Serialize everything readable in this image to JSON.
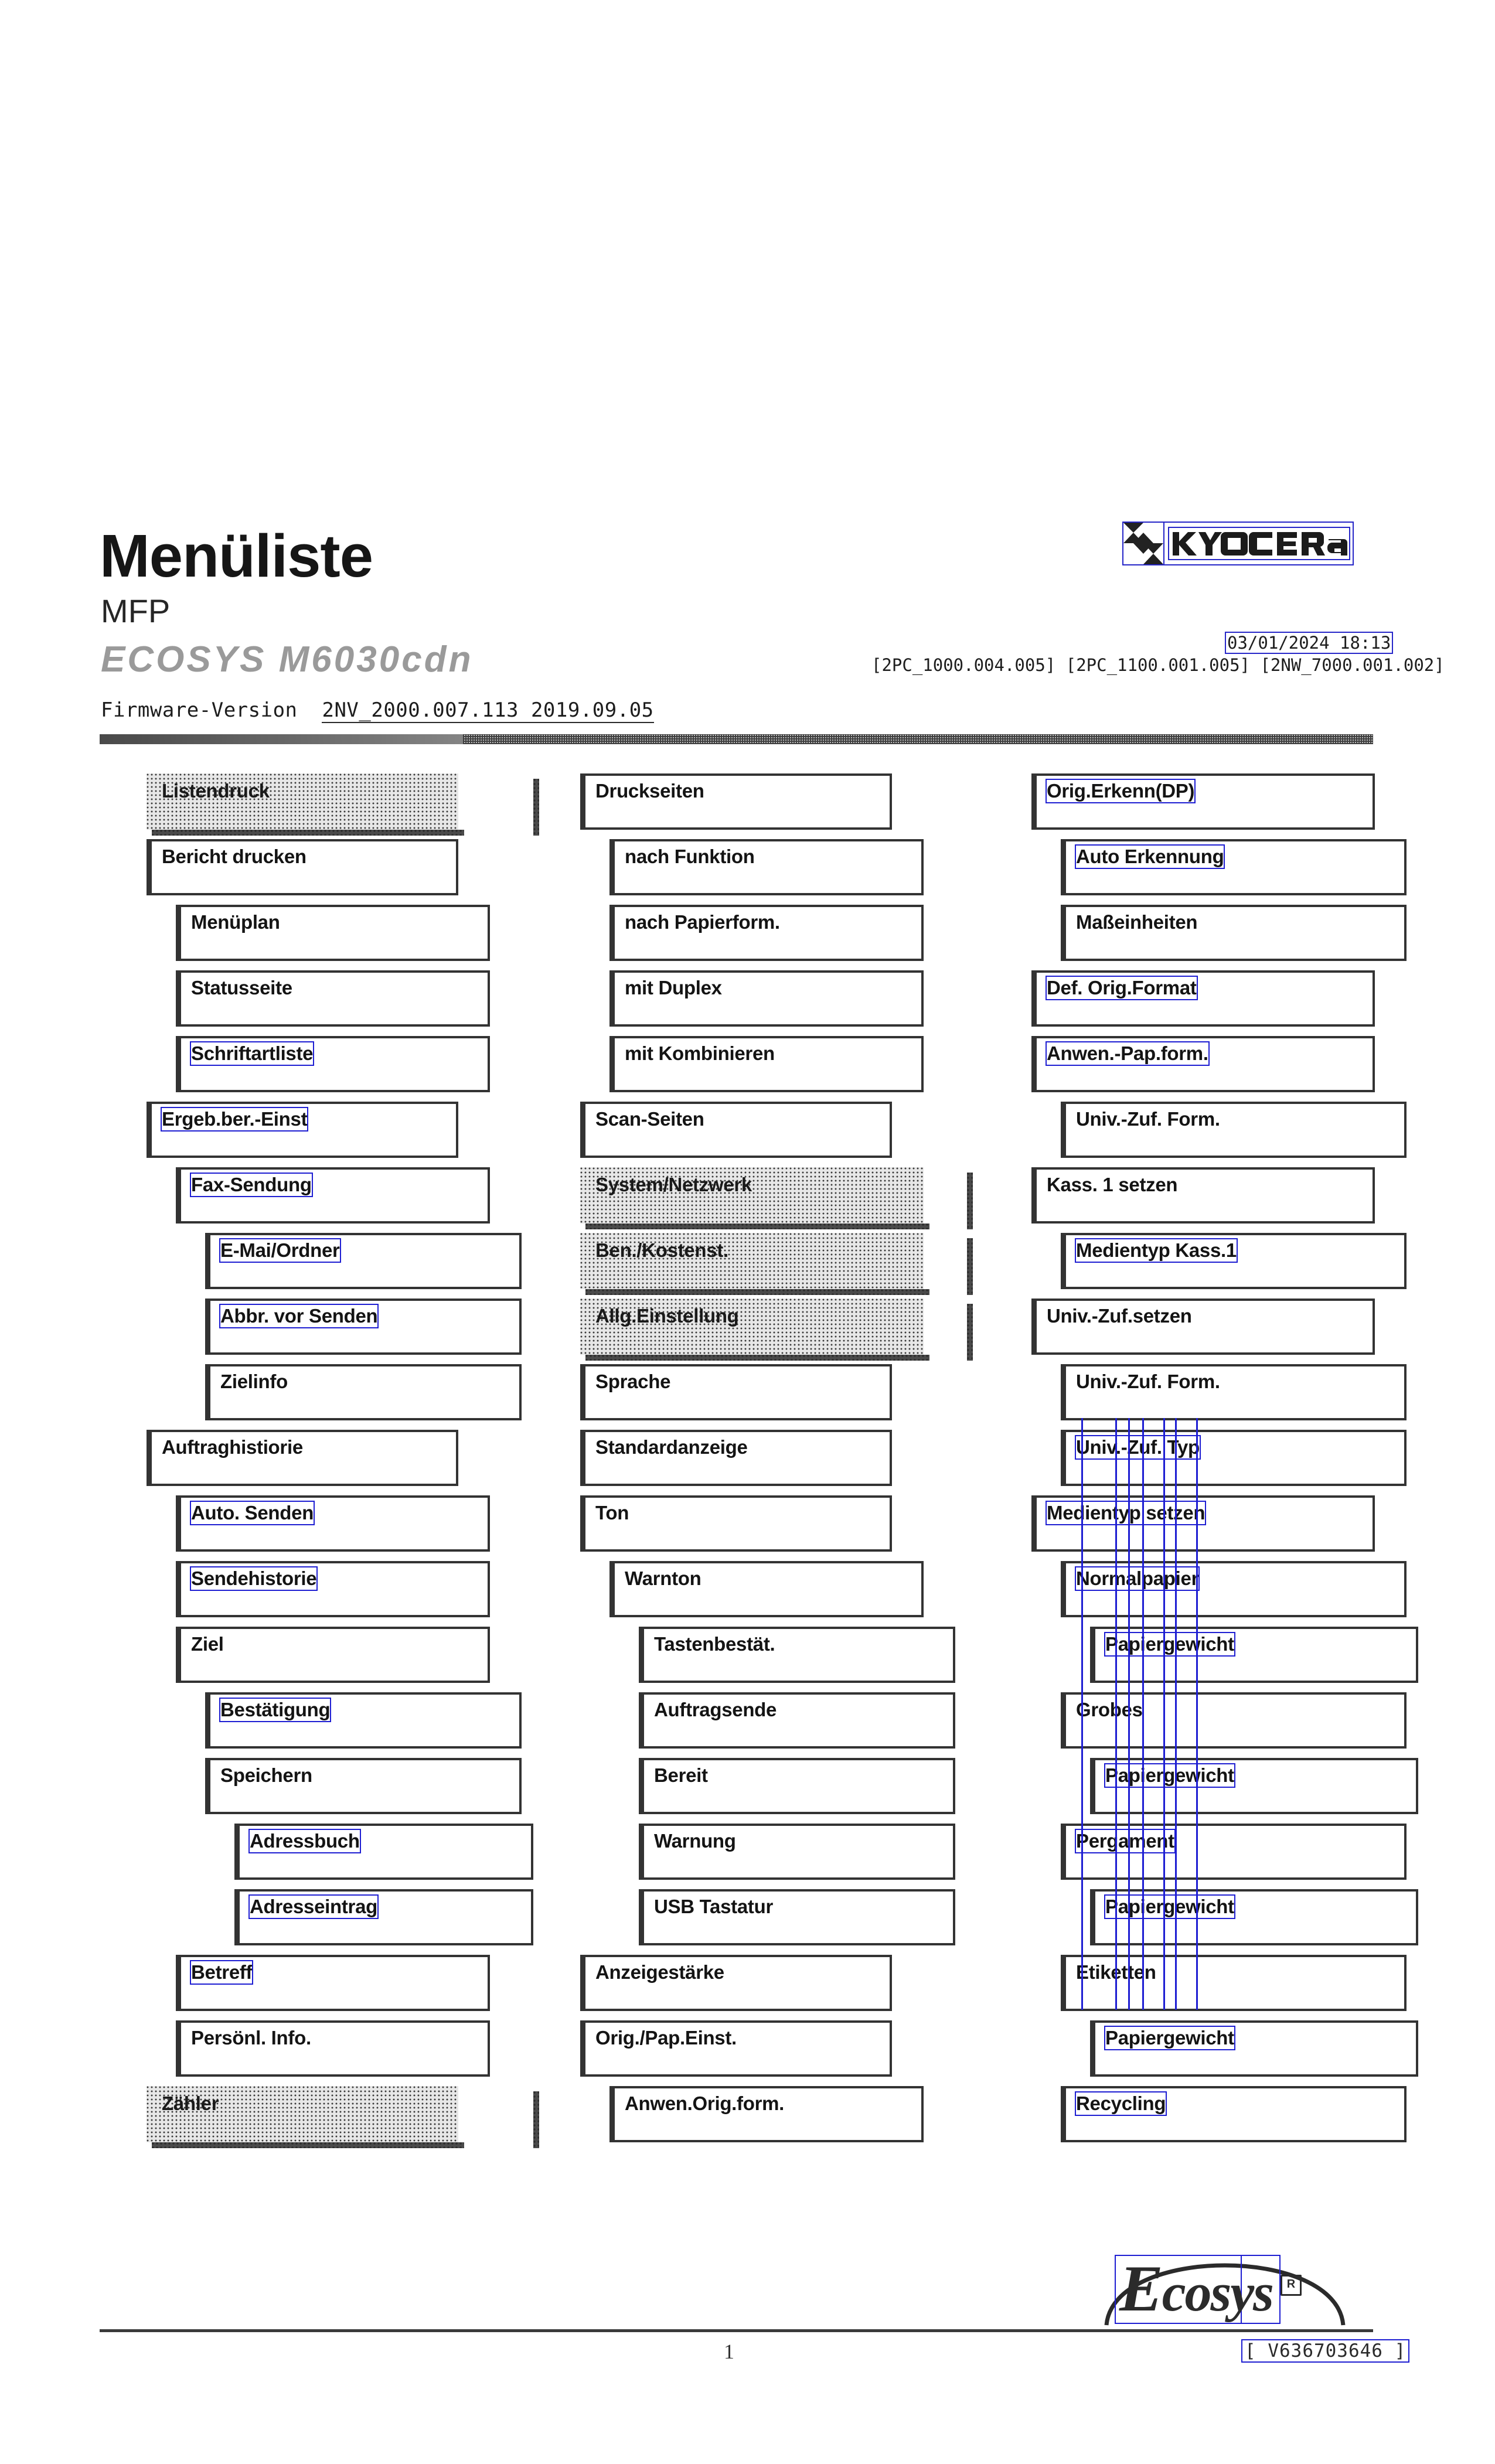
{
  "header": {
    "title": "Menüliste",
    "subtitle": "MFP",
    "model": "ECOSYS M6030cdn",
    "firmware_label": "Firmware-Version",
    "firmware_value": "2NV_2000.007.113 2019.09.05",
    "datestamp": "03/01/2024 18:13",
    "version_codes": "[2PC_1000.004.005] [2PC_1100.001.005] [2NW_7000.001.002]",
    "brand": "KYOCERA"
  },
  "columns": [
    {
      "name": "column-1",
      "nodes": [
        {
          "label": "Listendruck",
          "indent": 0,
          "width": 0,
          "shaded": true,
          "ocr": false
        },
        {
          "label": "Bericht drucken",
          "indent": 0,
          "width": 0,
          "shaded": false,
          "ocr": false
        },
        {
          "label": "Menüplan",
          "indent": 1,
          "width": 1,
          "shaded": false,
          "ocr": false
        },
        {
          "label": "Statusseite",
          "indent": 1,
          "width": 1,
          "shaded": false,
          "ocr": false
        },
        {
          "label": "Schriftartliste",
          "indent": 1,
          "width": 1,
          "shaded": false,
          "ocr": true
        },
        {
          "label": "Ergeb.ber.-Einst",
          "indent": 0,
          "width": 0,
          "shaded": false,
          "ocr": true
        },
        {
          "label": "Fax-Sendung",
          "indent": 1,
          "width": 1,
          "shaded": false,
          "ocr": true
        },
        {
          "label": "E-Mai/Ordner",
          "indent": 2,
          "width": 2,
          "shaded": false,
          "ocr": true
        },
        {
          "label": "Abbr. vor Senden",
          "indent": 2,
          "width": 2,
          "shaded": false,
          "ocr": true
        },
        {
          "label": "Zielinfo",
          "indent": 2,
          "width": 2,
          "shaded": false,
          "ocr": false
        },
        {
          "label": "Auftraghistiorie",
          "indent": 0,
          "width": 0,
          "shaded": false,
          "ocr": false
        },
        {
          "label": "Auto. Senden",
          "indent": 1,
          "width": 1,
          "shaded": false,
          "ocr": true
        },
        {
          "label": "Sendehistorie",
          "indent": 1,
          "width": 1,
          "shaded": false,
          "ocr": true
        },
        {
          "label": "Ziel",
          "indent": 1,
          "width": 1,
          "shaded": false,
          "ocr": false
        },
        {
          "label": "Bestätigung",
          "indent": 2,
          "width": 2,
          "shaded": false,
          "ocr": true
        },
        {
          "label": "Speichern",
          "indent": 2,
          "width": 2,
          "shaded": false,
          "ocr": false
        },
        {
          "label": "Adressbuch",
          "indent": 3,
          "width": 3,
          "shaded": false,
          "ocr": true
        },
        {
          "label": "Adresseintrag",
          "indent": 3,
          "width": 3,
          "shaded": false,
          "ocr": true
        },
        {
          "label": "Betreff",
          "indent": 1,
          "width": 1,
          "shaded": false,
          "ocr": true
        },
        {
          "label": "Persönl. Info.",
          "indent": 1,
          "width": 1,
          "shaded": false,
          "ocr": false
        },
        {
          "label": "Zähler",
          "indent": 0,
          "width": 0,
          "shaded": true,
          "ocr": false
        }
      ]
    },
    {
      "name": "column-2",
      "nodes": [
        {
          "label": "Druckseiten",
          "indent": 0,
          "width": 0,
          "shaded": false,
          "ocr": false
        },
        {
          "label": "nach Funktion",
          "indent": 1,
          "width": 1,
          "shaded": false,
          "ocr": false
        },
        {
          "label": "nach Papierform.",
          "indent": 1,
          "width": 1,
          "shaded": false,
          "ocr": false
        },
        {
          "label": "mit Duplex",
          "indent": 1,
          "width": 1,
          "shaded": false,
          "ocr": false
        },
        {
          "label": "mit Kombinieren",
          "indent": 1,
          "width": 1,
          "shaded": false,
          "ocr": false
        },
        {
          "label": "Scan-Seiten",
          "indent": 0,
          "width": 0,
          "shaded": false,
          "ocr": false
        },
        {
          "label": "System/Netzwerk",
          "indent": 0,
          "width": 1,
          "shaded": true,
          "ocr": false
        },
        {
          "label": "Ben./Kostenst.",
          "indent": 0,
          "width": 1,
          "shaded": true,
          "ocr": false
        },
        {
          "label": "Allg.Einstellung",
          "indent": 0,
          "width": 1,
          "shaded": true,
          "ocr": false
        },
        {
          "label": "Sprache",
          "indent": 0,
          "width": 0,
          "shaded": false,
          "ocr": false
        },
        {
          "label": "Standardanzeige",
          "indent": 0,
          "width": 0,
          "shaded": false,
          "ocr": false
        },
        {
          "label": "Ton",
          "indent": 0,
          "width": 0,
          "shaded": false,
          "ocr": false
        },
        {
          "label": "Warnton",
          "indent": 1,
          "width": 1,
          "shaded": false,
          "ocr": false
        },
        {
          "label": "Tastenbestät.",
          "indent": 2,
          "width": 2,
          "shaded": false,
          "ocr": false
        },
        {
          "label": "Auftragsende",
          "indent": 2,
          "width": 2,
          "shaded": false,
          "ocr": false
        },
        {
          "label": "Bereit",
          "indent": 2,
          "width": 2,
          "shaded": false,
          "ocr": false
        },
        {
          "label": "Warnung",
          "indent": 2,
          "width": 2,
          "shaded": false,
          "ocr": false
        },
        {
          "label": "USB Tastatur",
          "indent": 2,
          "width": 2,
          "shaded": false,
          "ocr": false
        },
        {
          "label": "Anzeigestärke",
          "indent": 0,
          "width": 0,
          "shaded": false,
          "ocr": false
        },
        {
          "label": "Orig./Pap.Einst.",
          "indent": 0,
          "width": 0,
          "shaded": false,
          "ocr": false
        },
        {
          "label": "Anwen.Orig.form.",
          "indent": 1,
          "width": 1,
          "shaded": false,
          "ocr": false
        }
      ]
    },
    {
      "name": "column-3",
      "nodes": [
        {
          "label": "Orig.Erkenn(DP)",
          "indent": 0,
          "width": 1,
          "shaded": false,
          "ocr": true
        },
        {
          "label": "Auto Erkennung",
          "indent": 1,
          "width": 2,
          "shaded": false,
          "ocr": true
        },
        {
          "label": "Maßeinheiten",
          "indent": 1,
          "width": 2,
          "shaded": false,
          "ocr": false
        },
        {
          "label": "Def. Orig.Format",
          "indent": 0,
          "width": 1,
          "shaded": false,
          "ocr": true
        },
        {
          "label": "Anwen.-Pap.form.",
          "indent": 0,
          "width": 1,
          "shaded": false,
          "ocr": true
        },
        {
          "label": "Univ.-Zuf. Form.",
          "indent": 1,
          "width": 2,
          "shaded": false,
          "ocr": false
        },
        {
          "label": "Kass. 1 setzen",
          "indent": 0,
          "width": 1,
          "shaded": false,
          "ocr": false
        },
        {
          "label": "Medientyp Kass.1",
          "indent": 1,
          "width": 2,
          "shaded": false,
          "ocr": true
        },
        {
          "label": "Univ.-Zuf.setzen",
          "indent": 0,
          "width": 1,
          "shaded": false,
          "ocr": false
        },
        {
          "label": "Univ.-Zuf. Form.",
          "indent": 1,
          "width": 2,
          "shaded": false,
          "ocr": false
        },
        {
          "label": "Univ.-Zuf. Typ",
          "indent": 1,
          "width": 2,
          "shaded": false,
          "ocr": true
        },
        {
          "label": "Medientyp setzen",
          "indent": 0,
          "width": 1,
          "shaded": false,
          "ocr": true
        },
        {
          "label": "Normalpapier",
          "indent": 1,
          "width": 2,
          "shaded": false,
          "ocr": true
        },
        {
          "label": "Papiergewicht",
          "indent": 2,
          "width": 3,
          "shaded": false,
          "ocr": true
        },
        {
          "label": "Grobes",
          "indent": 1,
          "width": 2,
          "shaded": false,
          "ocr": false
        },
        {
          "label": "Papiergewicht",
          "indent": 2,
          "width": 3,
          "shaded": false,
          "ocr": true
        },
        {
          "label": "Pergament",
          "indent": 1,
          "width": 2,
          "shaded": false,
          "ocr": true
        },
        {
          "label": "Papiergewicht",
          "indent": 2,
          "width": 3,
          "shaded": false,
          "ocr": true
        },
        {
          "label": "Etiketten",
          "indent": 1,
          "width": 2,
          "shaded": false,
          "ocr": false
        },
        {
          "label": "Papiergewicht",
          "indent": 2,
          "width": 3,
          "shaded": false,
          "ocr": true
        },
        {
          "label": "Recycling",
          "indent": 1,
          "width": 2,
          "shaded": false,
          "ocr": true
        }
      ]
    }
  ],
  "footer": {
    "logo_text": "Ecosys",
    "registered_mark": "R",
    "serial": "[ V636703646 ]",
    "page_number": "1"
  },
  "colors": {
    "ocr_blue": "#1e1ed2",
    "box_border": "#333333",
    "shade_gray": "#e7e7e7",
    "model_gray": "#9a9a9a"
  }
}
